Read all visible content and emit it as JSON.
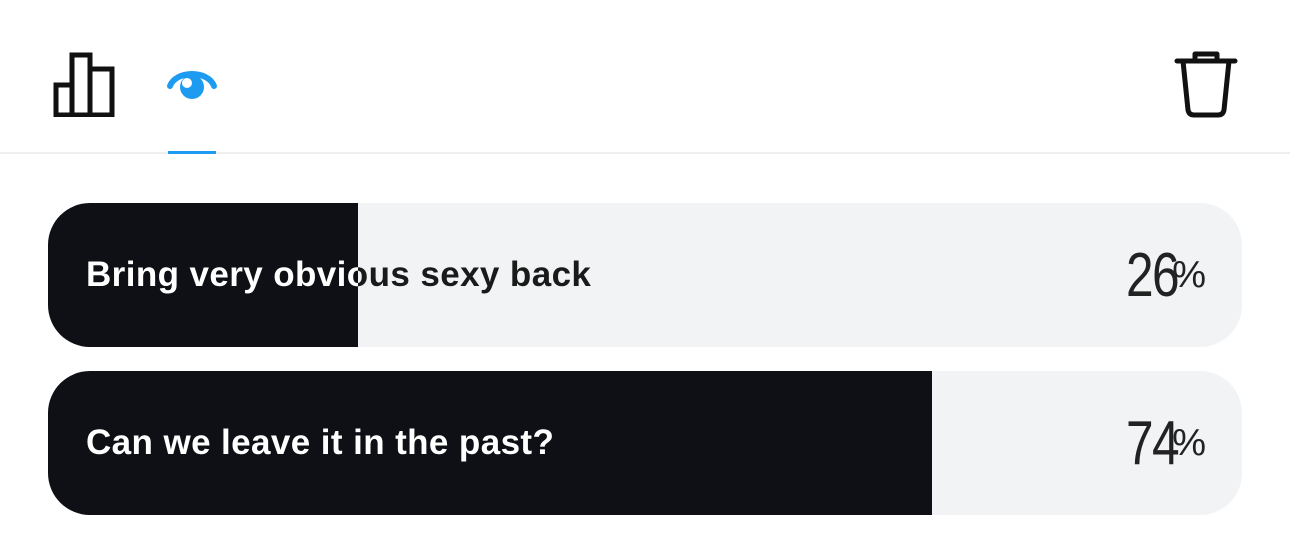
{
  "toolbar": {
    "results_icon": "bar-chart-icon",
    "viewers_icon": "eye-icon",
    "delete_icon": "trash-icon",
    "active_tab": "viewers",
    "accent_color": "#1d9bf0"
  },
  "poll": {
    "options": [
      {
        "label": "Bring very obvious sexy back",
        "percent": 26,
        "percent_text": "26",
        "unit": "%"
      },
      {
        "label": "Can we leave it in the past?",
        "percent": 74,
        "percent_text": "74",
        "unit": "%"
      }
    ],
    "fill_color": "#0e1016",
    "track_color": "#f2f3f5"
  }
}
